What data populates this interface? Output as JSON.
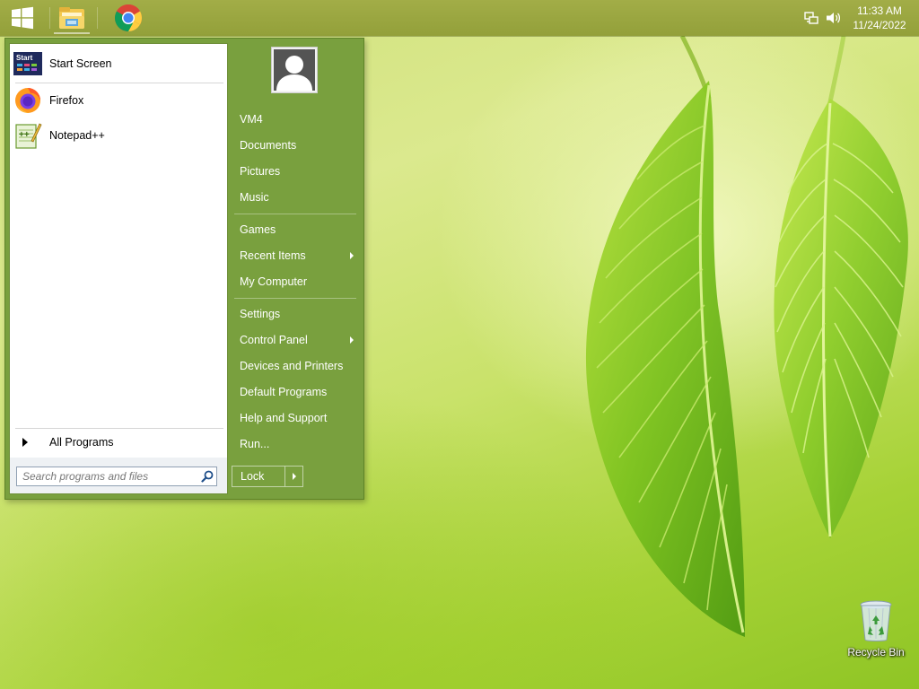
{
  "taskbar": {
    "apps": [
      {
        "name": "file-explorer",
        "icon": "file-explorer-icon"
      },
      {
        "name": "chrome",
        "icon": "chrome-icon"
      }
    ],
    "clock": {
      "time": "11:33 AM",
      "date": "11/24/2022"
    },
    "tray_icons": [
      "network-icon",
      "volume-icon"
    ]
  },
  "start_menu": {
    "pinned": [
      {
        "label": "Start Screen",
        "icon": "start-screen-icon"
      },
      {
        "label": "Firefox",
        "icon": "firefox-icon"
      },
      {
        "label": "Notepad++",
        "icon": "notepad-plus-plus-icon"
      }
    ],
    "all_programs": "All Programs",
    "search": {
      "placeholder": "Search programs and files",
      "value": ""
    },
    "user_name": "VM4",
    "right_items": [
      {
        "label": "VM4"
      },
      {
        "label": "Documents"
      },
      {
        "label": "Pictures"
      },
      {
        "label": "Music"
      },
      {
        "label": "Games"
      },
      {
        "label": "Recent Items"
      },
      {
        "label": "My Computer"
      },
      {
        "label": "Settings"
      },
      {
        "label": "Control Panel"
      },
      {
        "label": "Devices and Printers"
      },
      {
        "label": "Default Programs"
      },
      {
        "label": "Help and Support"
      },
      {
        "label": "Run..."
      }
    ],
    "lock_label": "Lock",
    "start_tile_text": "Start"
  },
  "desktop": {
    "icons": [
      {
        "label": "Recycle Bin",
        "icon": "recycle-bin-icon"
      }
    ]
  },
  "colors": {
    "taskbar": "#9aa640",
    "start_menu_right": "#79a03e",
    "start_menu_left": "#ffffff"
  }
}
